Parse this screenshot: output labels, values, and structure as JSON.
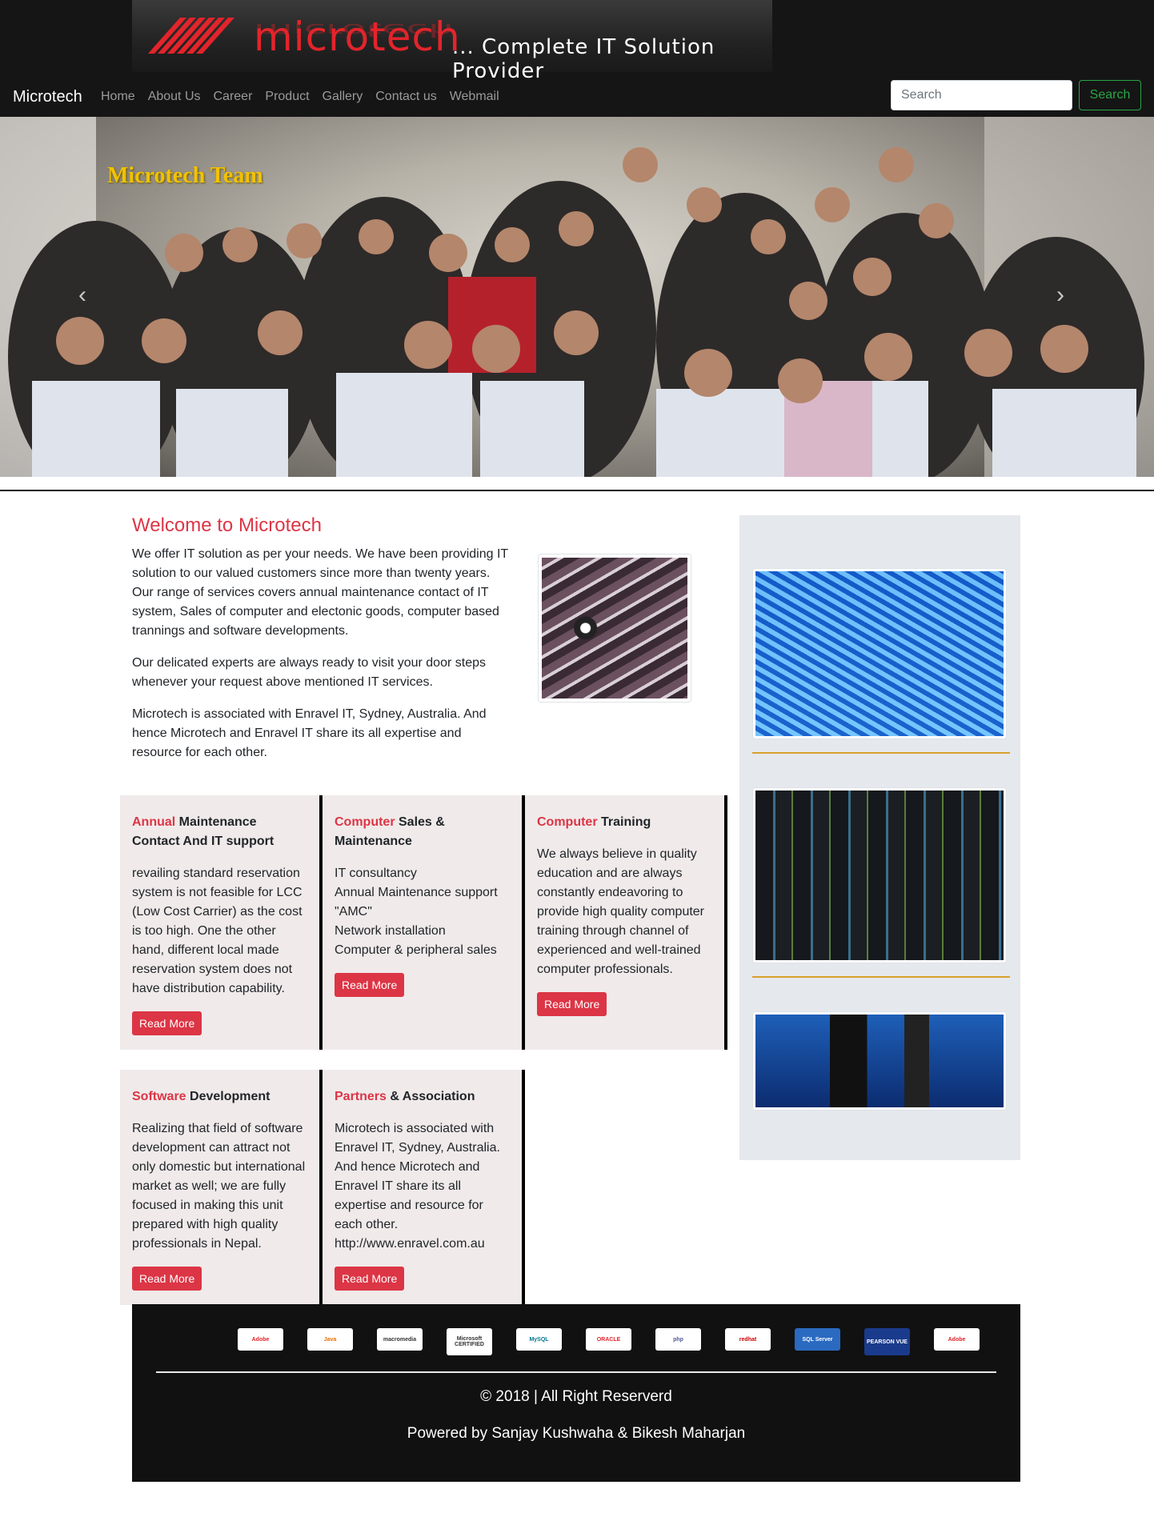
{
  "header": {
    "logo_word": "microtech",
    "tagline": "... Complete IT Solution Provider"
  },
  "navbar": {
    "brand": "Microtech",
    "links": [
      "Home",
      "About Us",
      "Career",
      "Product",
      "Gallery",
      "Contact us",
      "Webmail"
    ],
    "search_placeholder": "Search",
    "search_button": "Search"
  },
  "carousel": {
    "caption": "Microtech Team",
    "prev_glyph": "‹",
    "next_glyph": "›"
  },
  "welcome": {
    "title": "Welcome to Microtech",
    "paragraphs": [
      "We offer IT solution as per your needs. We have been providing IT solution to our valued customers since more than twenty years. Our range of services covers annual maintenance contact of IT system, Sales of computer and electonic goods, computer based trannings and software developments.",
      "Our delicated experts are always ready to visit your door steps whenever your request above mentioned IT services.",
      "Microtech is associated with Enravel IT, Sydney, Australia. And hence Microtech and Enravel IT share its all expertise and resource for each other."
    ]
  },
  "services": [
    {
      "highlight": "Annual",
      "rest": " Maintenance Contact And IT support",
      "body": "revailing standard reservation system is not feasible for LCC (Low Cost Carrier) as the cost is too high. One the other hand, different local made reservation system does not have distribution capability.",
      "button": "Read More"
    },
    {
      "highlight": "Computer",
      "rest": " Sales & Maintenance",
      "lines": [
        "IT consultancy",
        "Annual Maintenance support \"AMC\"",
        "Network installation",
        "Computer & peripheral sales"
      ],
      "button": "Read More"
    },
    {
      "highlight": "Computer",
      "rest": " Training",
      "body": "We always believe in quality education and are always constantly endeavoring to provide high quality computer training through channel of experienced and well-trained computer professionals.",
      "button": "Read More"
    },
    {
      "highlight": "Software",
      "rest": " Development",
      "body": "Realizing that field of software development can attract not only domestic but international market as well; we are fully focused in making this unit prepared with high quality professionals in Nepal.",
      "button": "Read More"
    },
    {
      "highlight": "Partners",
      "rest": " & Association",
      "body": "Microtech is associated with Enravel IT, Sydney, Australia. And hence Microtech and Enravel IT share its all expertise and resource for each other. http://www.enravel.com.au",
      "button": "Read More"
    }
  ],
  "footer": {
    "partners": [
      "Adobe",
      "Java",
      "macromedia",
      "Microsoft CERTIFIED",
      "MySQL",
      "ORACLE",
      "php",
      "redhat",
      "SQL Server",
      "PEARSON VUE",
      "Adobe"
    ],
    "copyright": "© 2018 | All Right Reserverd",
    "powered": "Powered by Sanjay Kushwaha & Bikesh Maharjan"
  },
  "colors": {
    "accent": "#dc3545",
    "nav_bg": "#151515",
    "card_bg": "#f0eaea",
    "sidebar_bg": "#e5e8ec",
    "separator": "#d8a12a",
    "search_btn": "#28a745"
  }
}
